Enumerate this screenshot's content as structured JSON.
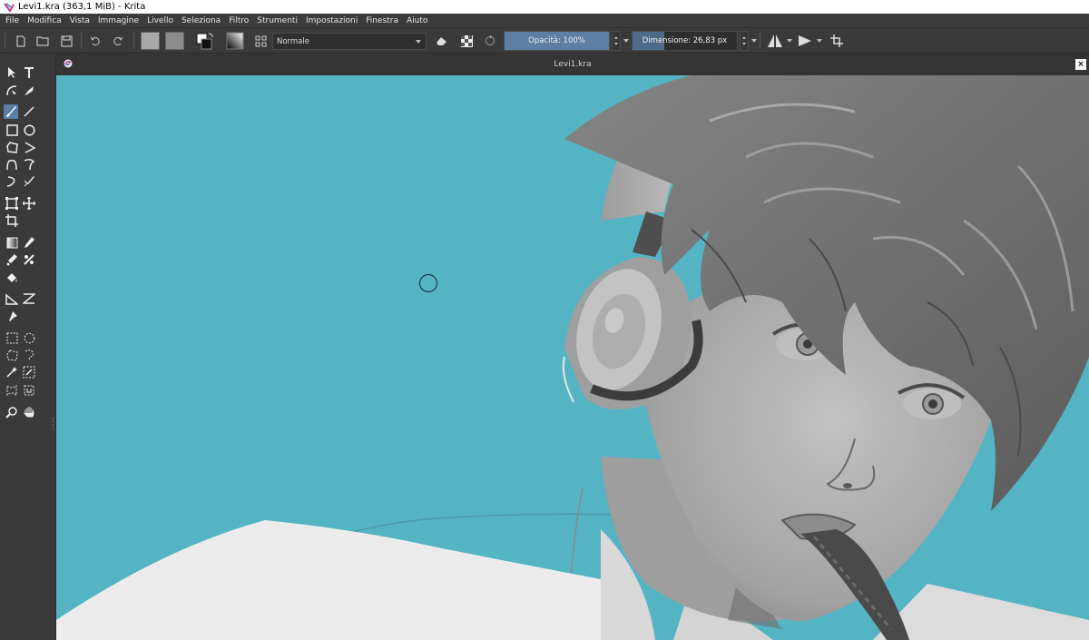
{
  "window": {
    "title": "Levi1.kra (363,1 MiB)  - Krita"
  },
  "menu": [
    "File",
    "Modifica",
    "Vista",
    "Immagine",
    "Livello",
    "Seleziona",
    "Filtro",
    "Strumenti",
    "Impostazioni",
    "Finestra",
    "Aiuto"
  ],
  "toolbar": {
    "blend_mode": "Normale",
    "opacity_label": "Opacità: 100%",
    "opacity_value": 100,
    "size_label": "Dimensione: 26,83 px"
  },
  "document": {
    "tab_title": "Levi1.kra",
    "close_glyph": "×"
  },
  "colors": {
    "canvas_bg": "#55b4c4",
    "accent": "#5c7fa3",
    "chrome": "#3a3a3a"
  },
  "icons": {
    "new": "new-document-icon",
    "open": "open-folder-icon",
    "save": "save-icon",
    "undo": "undo-icon",
    "redo": "redo-icon"
  }
}
